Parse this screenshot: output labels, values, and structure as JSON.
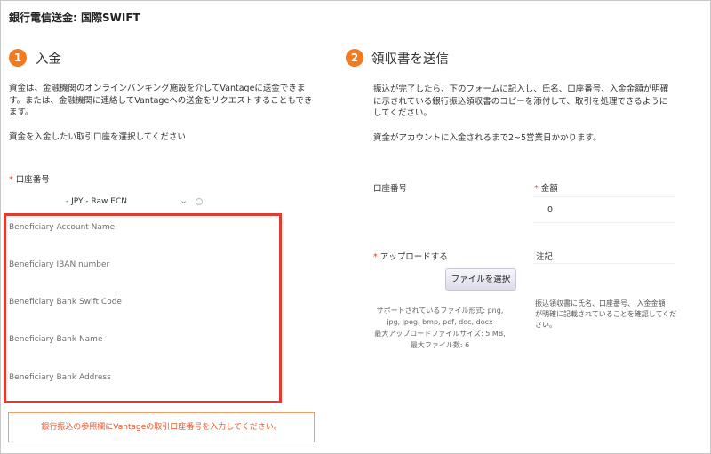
{
  "page_title": "銀行電信送金: 国際SWIFT",
  "step1": {
    "number": "1",
    "title": "入金",
    "description_line1": "資金は、金融機関のオンラインバンキング施設を介してVantageに送金できま",
    "description_line2": "す。または、金融機関に連絡してVantageへの送金をリクエストすることもでき",
    "description_line3": "ます。",
    "select_prompt": "資金を入金したい取引口座を選択してください",
    "account_label": "口座番号",
    "account_value": "- JPY - Raw ECN",
    "beneficiary_fields": [
      "Beneficiary Account Name",
      "Beneficiary IBAN number",
      "Beneficiary Bank Swift Code",
      "Beneficiary Bank Name",
      "Beneficiary Bank Address"
    ],
    "notice": "銀行振込の参照欄にVantageの取引口座番号を入力してください。"
  },
  "step2": {
    "number": "2",
    "title": "領収書を送信",
    "description_line1": "振込が完了したら、下のフォームに記入し、氏名、口座番号、入金金額が明確",
    "description_line2": "に示されている銀行振込領収書のコピーを添付して、取引を処理できるように",
    "description_line3": "してください。",
    "processing_note": "資金がアカウントに入金されるまで2~5営業日かかります。",
    "account_number_label": "口座番号",
    "amount_label": "金額",
    "amount_value": "0",
    "upload_label": "アップロードする",
    "file_button": "ファイルを選択",
    "supported_formats_line1": "サポートされているファイル形式: png,",
    "supported_formats_line2": "jpg, jpeg, bmp, pdf, doc, docx",
    "max_upload_size": "最大アップロードファイルサイズ: 5 MB,",
    "max_files": "最大ファイル数: 6",
    "memo_label": "注記",
    "memo_hint_line1": "振込領収書に氏名、口座番号、 入金金額",
    "memo_hint_line2": "が明確に記載されていることを確認してくだ",
    "memo_hint_line3": "さい。"
  },
  "colors": {
    "accent": "#f07b22",
    "highlight_border": "#e23b2e",
    "notice_text": "#e5562a",
    "required": "#e0402b"
  }
}
